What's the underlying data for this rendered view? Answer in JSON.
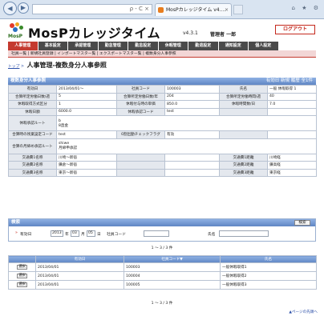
{
  "browser": {
    "back_icon": "back-arrow-icon",
    "forward_icon": "forward-arrow-icon",
    "address_icons": "ρ - C ×",
    "tab_title": "MosPカレッジタイム v4....",
    "tab_close": "×",
    "window_icons": "⌂ ★ ⚙"
  },
  "header": {
    "logo_text": "MosP",
    "app_name": "MosPカレッジタイム",
    "version": "v4.3.1",
    "user": "管理者 一郎",
    "logout_label": "ログアウト"
  },
  "menu": [
    {
      "label": "人事管理",
      "active": true
    },
    {
      "label": "基本設定"
    },
    {
      "label": "承認管理"
    },
    {
      "label": "勤怠管理"
    },
    {
      "label": "勤怠設定"
    },
    {
      "label": "休暇管理"
    },
    {
      "label": "勤退設定"
    },
    {
      "label": "通知設定"
    },
    {
      "label": "個人設定"
    }
  ],
  "submenu": "社員一覧 | 新規社員登録 | インポートマスター覧 | エクスポートマスター覧 | 複数身分人事参照",
  "breadcrumb": {
    "link": "トップ",
    "sep": ">",
    "current": "人事管理-複数身分人事参照"
  },
  "detail": {
    "title": "複数身分人事参照",
    "links": "有効日 新規 履歴 全1件",
    "rows": [
      [
        "有効日",
        "2013/04/01〜",
        "社員コード",
        "100003",
        "氏名",
        "一般 休暇取得 1"
      ],
      [
        "合算所定労働日数/週",
        "5",
        "合算所定労働日数/年",
        "204",
        "合算所定労働時間/週",
        "40"
      ],
      [
        "休暇取得方式区分",
        "1",
        "休暇付与時の単価",
        "850.0",
        "休暇時間数/日",
        "7.0"
      ],
      [
        "休暇日額",
        "6000.0",
        "休暇承認コード",
        "test",
        "",
        ""
      ],
      [
        "休暇承認ルート",
        "b\n8直金",
        "",
        "",
        "",
        ""
      ],
      [
        "合算時の残業設定コード",
        "test",
        "0割出勤チェックフラグ",
        "有効",
        "",
        ""
      ],
      [
        "合算の月締め承認ルート",
        "shiwe\n月締申承認",
        "",
        "",
        "",
        ""
      ],
      [
        "交通費1名称",
        "川崎〜新宿",
        "",
        "",
        "交通費1距離",
        "川崎経"
      ],
      [
        "交通費2名称",
        "鎌倉〜新宿",
        "",
        "",
        "交通費2距離",
        "鎌高経"
      ],
      [
        "交通費3名称",
        "東京〜新宿",
        "",
        "",
        "交通費3距離",
        "東京経"
      ]
    ]
  },
  "search": {
    "title": "検索",
    "button": "検索",
    "date_label": "有効日",
    "year": "2013",
    "year_unit": "年",
    "month": "03",
    "month_unit": "月",
    "day": "05",
    "day_unit": "日",
    "emp_code_label": "社員コード",
    "emp_code_value": "",
    "name_label": "氏名",
    "name_value": ""
  },
  "pager_top": "1 〜 3 / 3 件",
  "list": {
    "headers": [
      "",
      "有効日",
      "社員コード▼",
      "氏名"
    ],
    "select_label": "選択",
    "rows": [
      [
        "2013/04/01",
        "100003",
        "一般休暇取得1"
      ],
      [
        "2013/04/01",
        "100004",
        "一般休暇取得2"
      ],
      [
        "2013/04/01",
        "100005",
        "一般休暇取得3"
      ]
    ]
  },
  "pager_bottom": "1 〜 3 / 3 件",
  "to_top": "▲ページの先頭へ"
}
